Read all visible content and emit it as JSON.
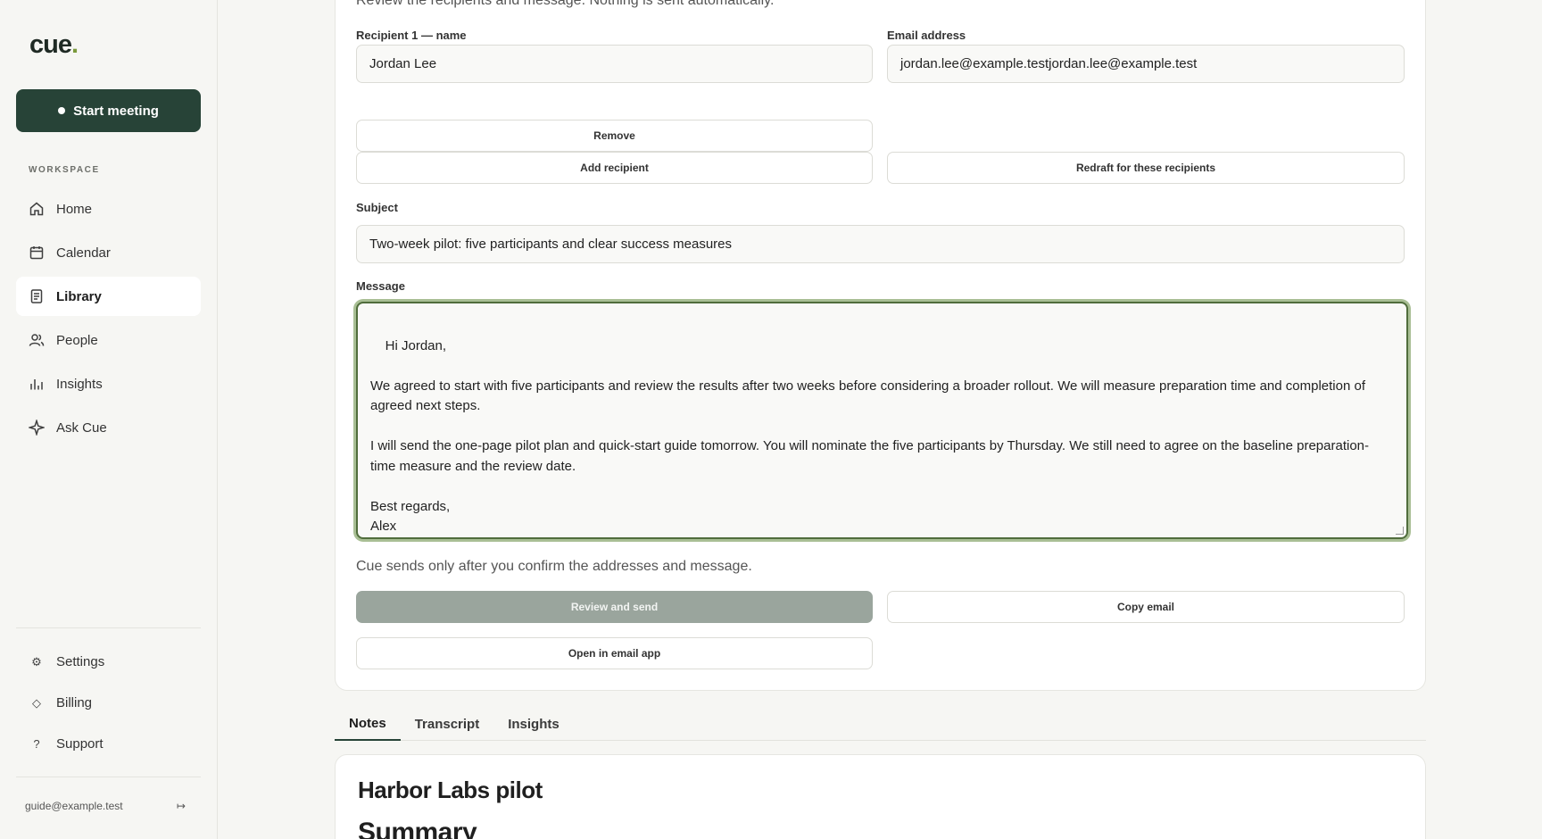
{
  "brand": {
    "logo_text": "cue",
    "logo_dot": "."
  },
  "sidebar": {
    "start_meeting": "Start meeting",
    "section_label": "WORKSPACE",
    "items": [
      {
        "label": "Home",
        "icon": "home-icon"
      },
      {
        "label": "Calendar",
        "icon": "calendar-icon"
      },
      {
        "label": "Library",
        "icon": "document-icon",
        "active": true
      },
      {
        "label": "People",
        "icon": "people-icon"
      },
      {
        "label": "Insights",
        "icon": "bar-chart-icon"
      },
      {
        "label": "Ask Cue",
        "icon": "sparkle-icon"
      }
    ],
    "bottom_items": [
      {
        "label": "Settings",
        "icon": "gear-icon",
        "glyph": "⚙"
      },
      {
        "label": "Billing",
        "icon": "diamond-icon",
        "glyph": "◇"
      },
      {
        "label": "Support",
        "icon": "question-icon",
        "glyph": "?"
      }
    ],
    "account_email": "guide@example.test",
    "signout_glyph": "↦"
  },
  "email_panel": {
    "intro": "Review the recipients and message. Nothing is sent automatically.",
    "recipient_name_label": "Recipient 1 — name",
    "recipient_name_value": "Jordan Lee",
    "email_label": "Email address",
    "email_value": "jordan.lee@example.testjordan.lee@example.test",
    "remove_label": "Remove",
    "add_recipient_label": "Add recipient",
    "redraft_label": "Redraft for these recipients",
    "subject_label": "Subject",
    "subject_value": "Two-week pilot: five participants and clear success measures",
    "message_label": "Message",
    "message_value": "Hi Jordan,\n\nWe agreed to start with five participants and review the results after two weeks before considering a broader rollout. We will measure preparation time and completion of agreed next steps.\n\nI will send the one-page pilot plan and quick-start guide tomorrow. You will nominate the five participants by Thursday. We still need to agree on the baseline preparation-time measure and the review date.\n\nBest regards,\nAlex",
    "confirm_note": "Cue sends only after you confirm the addresses and message.",
    "review_send_label": "Review and send",
    "copy_email_label": "Copy email",
    "open_email_app_label": "Open in email app"
  },
  "tabs": [
    {
      "label": "Notes",
      "active": true
    },
    {
      "label": "Transcript"
    },
    {
      "label": "Insights"
    }
  ],
  "notes": {
    "title": "Harbor Labs pilot",
    "section_heading": "Summary"
  },
  "colors": {
    "primary": "#274337",
    "accent": "#7a9a3b",
    "disabled_button": "#9aa59d",
    "focus_ring": "#506d3c"
  }
}
